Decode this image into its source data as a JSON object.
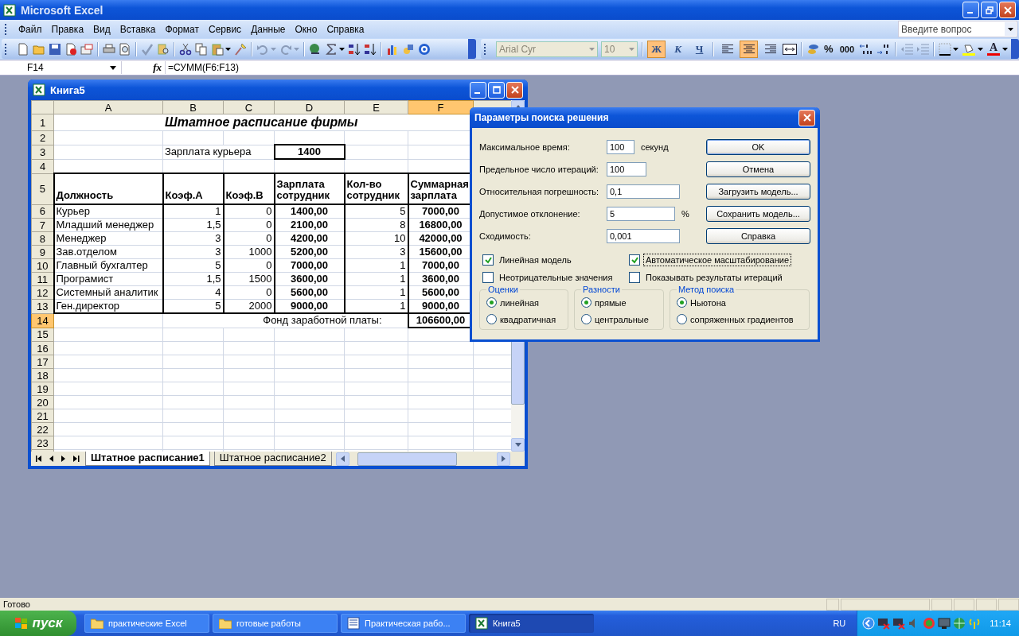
{
  "app": {
    "title": "Microsoft Excel"
  },
  "menu": [
    "Файл",
    "Правка",
    "Вид",
    "Вставка",
    "Формат",
    "Сервис",
    "Данные",
    "Окно",
    "Справка"
  ],
  "help_search": {
    "placeholder": "Введите вопрос"
  },
  "format_toolbar": {
    "font": {
      "value": "Arial Cyr",
      "disabled": true
    },
    "size": {
      "value": "10",
      "disabled": true
    },
    "style_buttons": [
      {
        "label": "Ж",
        "selected": true
      },
      {
        "label": "К",
        "selected": false
      },
      {
        "label": "Ч",
        "selected": false
      }
    ],
    "align_buttons": [
      {
        "selected": false
      },
      {
        "selected": true
      },
      {
        "selected": false
      }
    ],
    "percent": "%",
    "thousands": "000",
    "font_color": "A"
  },
  "formula_bar": {
    "name_box": "F14",
    "fx": "fx",
    "formula": "=СУММ(F6:F13)"
  },
  "workbook": {
    "title": "Книга5",
    "columns": [
      {
        "label": "A",
        "selected": false
      },
      {
        "label": "B",
        "selected": false
      },
      {
        "label": "C",
        "selected": false
      },
      {
        "label": "D",
        "selected": false
      },
      {
        "label": "E",
        "selected": false
      },
      {
        "label": "F",
        "selected": true
      }
    ],
    "rows": [
      {
        "num": "1",
        "selected": false,
        "cells": [
          {
            "kind": "empty"
          },
          {
            "kind": "title",
            "text": "Штатное расписание фирмы"
          },
          {
            "kind": "empty"
          }
        ]
      },
      {
        "num": "2",
        "selected": false
      },
      {
        "num": "3",
        "selected": false,
        "cells": [
          {
            "kind": "empty"
          },
          {
            "kind": "label",
            "text": "Зарплата курьера"
          },
          {
            "kind": "input",
            "text": "1400"
          },
          {
            "kind": "empty"
          },
          {
            "kind": "empty"
          }
        ]
      },
      {
        "num": "4",
        "selected": false
      },
      {
        "num": "5",
        "selected": false,
        "cells": [
          {
            "kind": "header",
            "text": "Должность"
          },
          {
            "kind": "header",
            "text": "Коэф.А"
          },
          {
            "kind": "header",
            "text": "Коэф.В"
          },
          {
            "kind": "header",
            "text": "Зарплата сотрудник"
          },
          {
            "kind": "header",
            "text": "Кол-во сотрудник"
          },
          {
            "kind": "header",
            "text": "Суммарная зарплата"
          }
        ]
      },
      {
        "num": "6",
        "selected": false,
        "cells": [
          {
            "kind": "text",
            "text": "Курьер"
          },
          {
            "kind": "number",
            "text": "1"
          },
          {
            "kind": "number",
            "text": "0"
          },
          {
            "kind": "money",
            "text": "1400,00"
          },
          {
            "kind": "number",
            "text": "5"
          },
          {
            "kind": "money",
            "text": "7000,00"
          }
        ]
      },
      {
        "num": "7",
        "selected": false,
        "cells": [
          {
            "kind": "text",
            "text": "Младший менеджер"
          },
          {
            "kind": "number",
            "text": "1,5"
          },
          {
            "kind": "number",
            "text": "0"
          },
          {
            "kind": "money",
            "text": "2100,00"
          },
          {
            "kind": "number",
            "text": "8"
          },
          {
            "kind": "money",
            "text": "16800,00"
          }
        ]
      },
      {
        "num": "8",
        "selected": false,
        "cells": [
          {
            "kind": "text",
            "text": "Менеджер"
          },
          {
            "kind": "number",
            "text": "3"
          },
          {
            "kind": "number",
            "text": "0"
          },
          {
            "kind": "money",
            "text": "4200,00"
          },
          {
            "kind": "number",
            "text": "10"
          },
          {
            "kind": "money",
            "text": "42000,00"
          }
        ]
      },
      {
        "num": "9",
        "selected": false,
        "cells": [
          {
            "kind": "text",
            "text": "Зав.отделом"
          },
          {
            "kind": "number",
            "text": "3"
          },
          {
            "kind": "number",
            "text": "1000"
          },
          {
            "kind": "money",
            "text": "5200,00"
          },
          {
            "kind": "number",
            "text": "3"
          },
          {
            "kind": "money",
            "text": "15600,00"
          }
        ]
      },
      {
        "num": "10",
        "selected": false,
        "cells": [
          {
            "kind": "text",
            "text": "Главный бухгалтер"
          },
          {
            "kind": "number",
            "text": "5"
          },
          {
            "kind": "number",
            "text": "0"
          },
          {
            "kind": "money",
            "text": "7000,00"
          },
          {
            "kind": "number",
            "text": "1"
          },
          {
            "kind": "money",
            "text": "7000,00"
          }
        ]
      },
      {
        "num": "11",
        "selected": false,
        "cells": [
          {
            "kind": "text",
            "text": "Програмист"
          },
          {
            "kind": "number",
            "text": "1,5"
          },
          {
            "kind": "number",
            "text": "1500"
          },
          {
            "kind": "money",
            "text": "3600,00"
          },
          {
            "kind": "number",
            "text": "1"
          },
          {
            "kind": "money",
            "text": "3600,00"
          }
        ]
      },
      {
        "num": "12",
        "selected": false,
        "cells": [
          {
            "kind": "text",
            "text": "Системный аналитик"
          },
          {
            "kind": "number",
            "text": "4"
          },
          {
            "kind": "number",
            "text": "0"
          },
          {
            "kind": "money",
            "text": "5600,00"
          },
          {
            "kind": "number",
            "text": "1"
          },
          {
            "kind": "money",
            "text": "5600,00"
          }
        ]
      },
      {
        "num": "13",
        "selected": false,
        "cells": [
          {
            "kind": "text",
            "text": "Ген.директор"
          },
          {
            "kind": "number",
            "text": "5"
          },
          {
            "kind": "number",
            "text": "2000"
          },
          {
            "kind": "money",
            "text": "9000,00"
          },
          {
            "kind": "number",
            "text": "1"
          },
          {
            "kind": "money",
            "text": "9000,00"
          }
        ]
      },
      {
        "num": "14",
        "selected": true,
        "cells": [
          {
            "kind": "empty"
          },
          {
            "kind": "total-label",
            "text": "Фонд заработной платы:"
          },
          {
            "kind": "total",
            "text": "106600,00"
          }
        ]
      },
      {
        "num": "15",
        "selected": false
      },
      {
        "num": "16",
        "selected": false
      },
      {
        "num": "17",
        "selected": false
      },
      {
        "num": "18",
        "selected": false
      },
      {
        "num": "19",
        "selected": false
      },
      {
        "num": "20",
        "selected": false
      },
      {
        "num": "21",
        "selected": false
      },
      {
        "num": "22",
        "selected": false
      },
      {
        "num": "23",
        "selected": false
      }
    ],
    "sheet_tabs": [
      {
        "label": "Штатное расписание1",
        "selected": true
      },
      {
        "label": "Штатное расписание2",
        "selected": false
      }
    ]
  },
  "dialog": {
    "title": "Параметры поиска решения",
    "fields": [
      {
        "label": "Максимальное время:",
        "value": "100",
        "unit": "секунд"
      },
      {
        "label": "Предельное число итераций:",
        "value": "100"
      },
      {
        "label": "Относительная погрешность:",
        "value": "0,1"
      },
      {
        "label": "Допустимое отклонение:",
        "value": "5",
        "unit": "%"
      },
      {
        "label": "Сходимость:",
        "value": "0,001"
      }
    ],
    "buttons": [
      "OK",
      "Отмена",
      "Загрузить модель...",
      "Сохранить модель...",
      "Справка"
    ],
    "checkboxes": [
      {
        "label": "Линейная модель",
        "checked": true,
        "focused": false
      },
      {
        "label": "Автоматическое масштабирование",
        "checked": true,
        "focused": true
      },
      {
        "label": "Неотрицательные значения",
        "checked": false,
        "focused": false
      },
      {
        "label": "Показывать результаты итераций",
        "checked": false,
        "focused": false
      }
    ],
    "groups": [
      {
        "title": "Оценки",
        "options": [
          {
            "label": "линейная",
            "selected": true
          },
          {
            "label": "квадратичная",
            "selected": false
          }
        ]
      },
      {
        "title": "Разности",
        "options": [
          {
            "label": "прямые",
            "selected": true
          },
          {
            "label": "центральные",
            "selected": false
          }
        ]
      },
      {
        "title": "Метод поиска",
        "options": [
          {
            "label": "Ньютона",
            "selected": true
          },
          {
            "label": "сопряженных градиентов",
            "selected": false
          }
        ]
      }
    ]
  },
  "status_bar": {
    "text": "Готово"
  },
  "taskbar": {
    "start": "пуск",
    "tasks": [
      {
        "label": "практические Excel",
        "selected": false
      },
      {
        "label": "готовые работы",
        "selected": false
      },
      {
        "label": "Практическая рабо...",
        "selected": false
      },
      {
        "label": "Книга5",
        "selected": true
      }
    ],
    "language": "RU",
    "clock": "11:14"
  }
}
